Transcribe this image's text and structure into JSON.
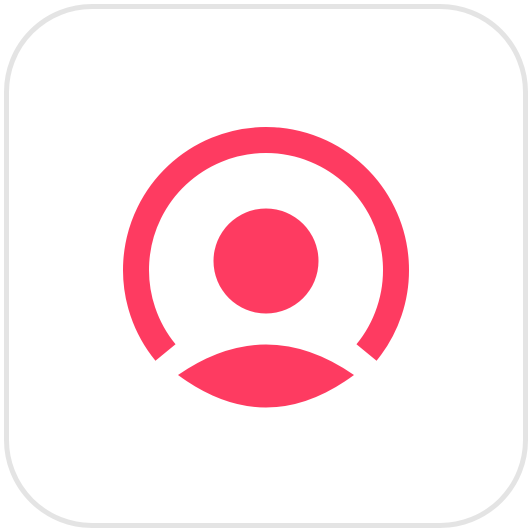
{
  "app_icon": {
    "name": "user-profile-icon",
    "accent_color": "#fe3b61",
    "border_color": "#e4e4e4",
    "background_color": "#ffffff"
  }
}
